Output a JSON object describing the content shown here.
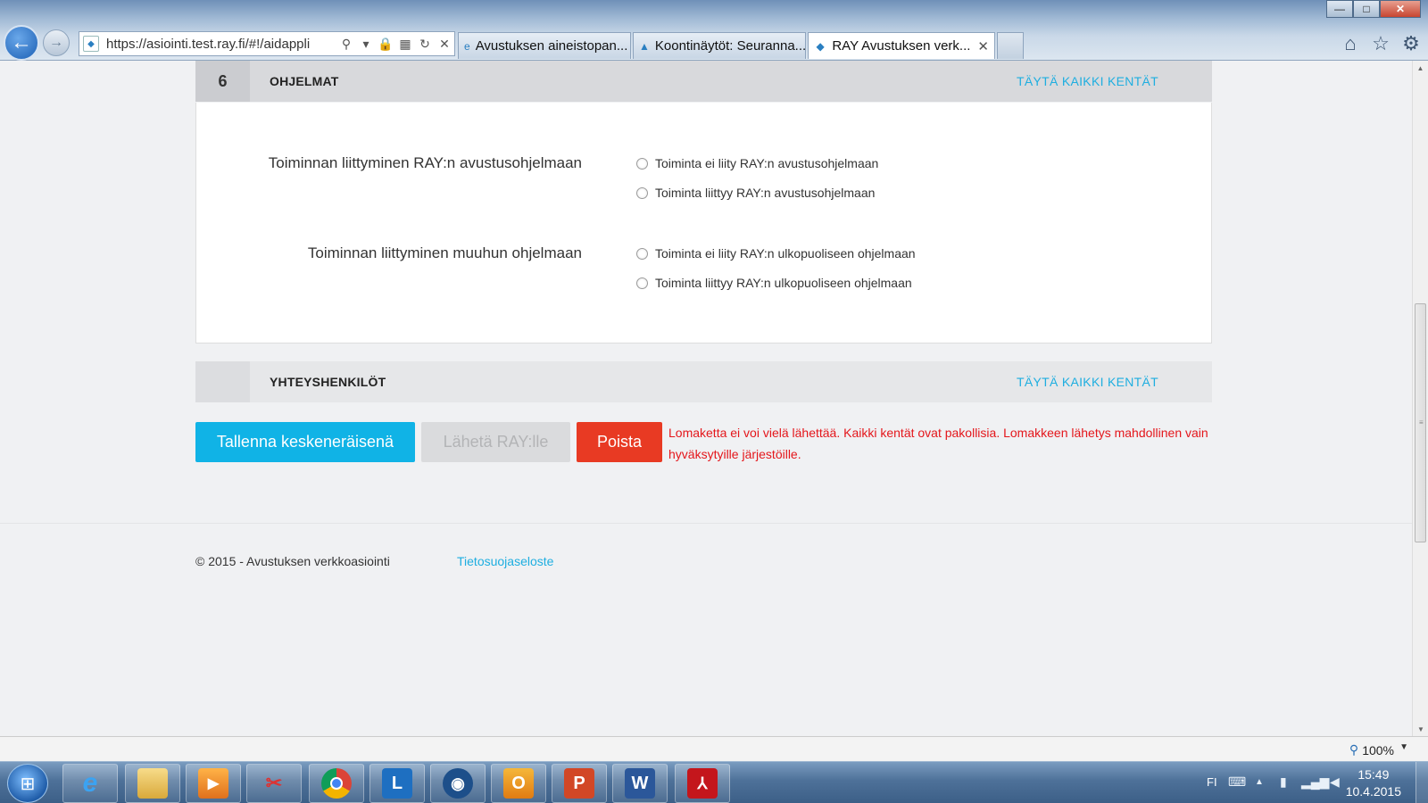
{
  "browser": {
    "url": "https://asiointi.test.ray.fi/#!/aidappli",
    "tabs": [
      {
        "label": "Avustuksen aineistopan..."
      },
      {
        "label": "Koontinäytöt: Seuranna..."
      },
      {
        "label": "RAY Avustuksen verk..."
      }
    ],
    "window_controls": {
      "minimize": "—",
      "maximize": "□",
      "close": "✕"
    },
    "zoom": "100%"
  },
  "section6": {
    "number": "6",
    "title": "OHJELMAT",
    "fill_all": "TÄYTÄ KAIKKI KENTÄT",
    "q1": {
      "label": "Toiminnan liittyminen RAY:n avustusohjelmaan",
      "options": [
        "Toiminta ei liity RAY:n avustusohjelmaan",
        "Toiminta liittyy RAY:n avustusohjelmaan"
      ]
    },
    "q2": {
      "label": "Toiminnan liittyminen muuhun ohjelmaan",
      "options": [
        "Toiminta ei liity RAY:n ulkopuoliseen ohjelmaan",
        "Toiminta liittyy RAY:n ulkopuoliseen ohjelmaan"
      ]
    }
  },
  "section7": {
    "number": "",
    "title": "YHTEYSHENKILÖT",
    "fill_all": "TÄYTÄ KAIKKI KENTÄT"
  },
  "actions": {
    "save": "Tallenna keskeneräisenä",
    "send": "Lähetä RAY:lle",
    "delete": "Poista",
    "error": "Lomaketta ei voi vielä lähettää. Kaikki kentät ovat pakollisia. Lomakkeen lähetys mahdollinen vain hyväksytyille järjestöille."
  },
  "footer": {
    "copyright": "© 2015 - Avustuksen verkkoasiointi",
    "privacy": "Tietosuojaseloste"
  },
  "taskbar": {
    "language": "FI",
    "time": "15:49",
    "date": "10.4.2015",
    "apps": [
      "internet-explorer",
      "file-explorer",
      "media-player",
      "snipping-tool",
      "chrome",
      "lync",
      "network",
      "outlook",
      "powerpoint",
      "word",
      "acrobat"
    ]
  },
  "colors": {
    "accent": "#10b3e6",
    "link": "#1eaee0",
    "danger": "#e83a23",
    "error_text": "#e4161b"
  }
}
